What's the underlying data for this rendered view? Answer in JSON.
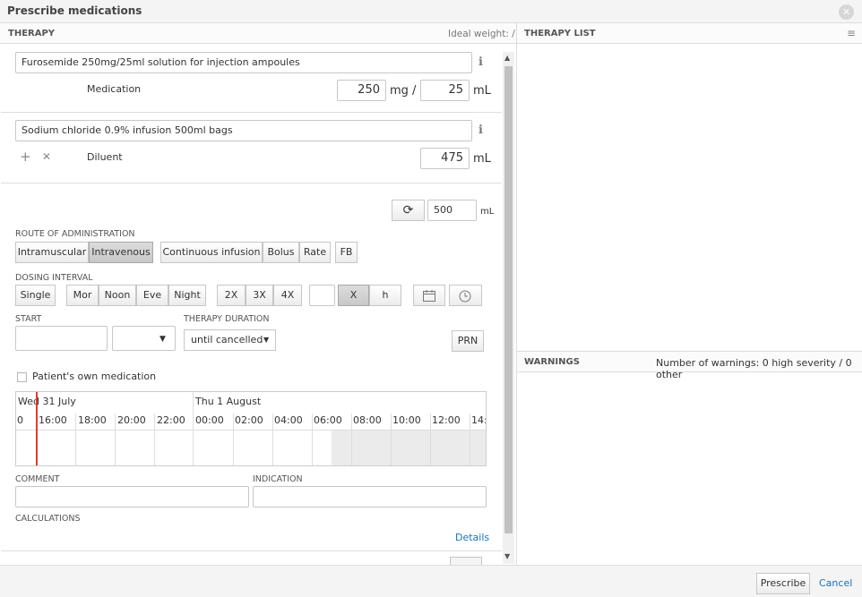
{
  "window": {
    "title": "Prescribe medications"
  },
  "therapy_header": {
    "title": "THERAPY",
    "ideal_weight": "Ideal weight: /"
  },
  "therapy_list_header": {
    "title": "THERAPY LIST"
  },
  "medication": {
    "name": "Furosemide 250mg/25ml solution for injection ampoules",
    "label": "Medication",
    "dose_value": "250",
    "dose_unit": "mg /",
    "volume_value": "25",
    "volume_unit": "mL"
  },
  "diluent": {
    "name": "Sodium chloride 0.9% infusion 500ml bags",
    "label": "Diluent",
    "volume_value": "475",
    "volume_unit": "mL"
  },
  "total": {
    "value": "500",
    "unit": "mL"
  },
  "route": {
    "label": "ROUTE OF ADMINISTRATION",
    "options": [
      "Intramuscular",
      "Intravenous"
    ],
    "modes": [
      "Continuous infusion",
      "Bolus",
      "Rate"
    ],
    "extra": "FB"
  },
  "dosing": {
    "label": "DOSING INTERVAL",
    "single": "Single",
    "times": [
      "Mor",
      "Noon",
      "Eve",
      "Night"
    ],
    "freq": [
      "2X",
      "3X",
      "4X"
    ],
    "x_label": "X",
    "h_label": "h"
  },
  "start": {
    "label": "START"
  },
  "duration": {
    "label": "THERAPY DURATION",
    "value": "until cancelled"
  },
  "prn": "PRN",
  "own_med": "Patient's own medication",
  "timeline": {
    "day1": "Wed 31 July",
    "day2": "Thu 1 August",
    "hours": [
      "0",
      "16:00",
      "18:00",
      "20:00",
      "22:00",
      "00:00",
      "02:00",
      "04:00",
      "06:00",
      "08:00",
      "10:00",
      "12:00",
      "14:0"
    ]
  },
  "comment": {
    "label": "COMMENT"
  },
  "indication": {
    "label": "INDICATION"
  },
  "calculations": {
    "label": "CALCULATIONS",
    "details": "Details"
  },
  "warnings": {
    "title": "WARNINGS",
    "count": "Number of warnings: 0 high severity / 0 other"
  },
  "footer": {
    "prescribe": "Prescribe",
    "cancel": "Cancel"
  },
  "icons": {
    "info": "ℹ",
    "plus": "+",
    "times": "✕",
    "refresh": "⟳",
    "caret": "▾",
    "menu": "≡"
  }
}
